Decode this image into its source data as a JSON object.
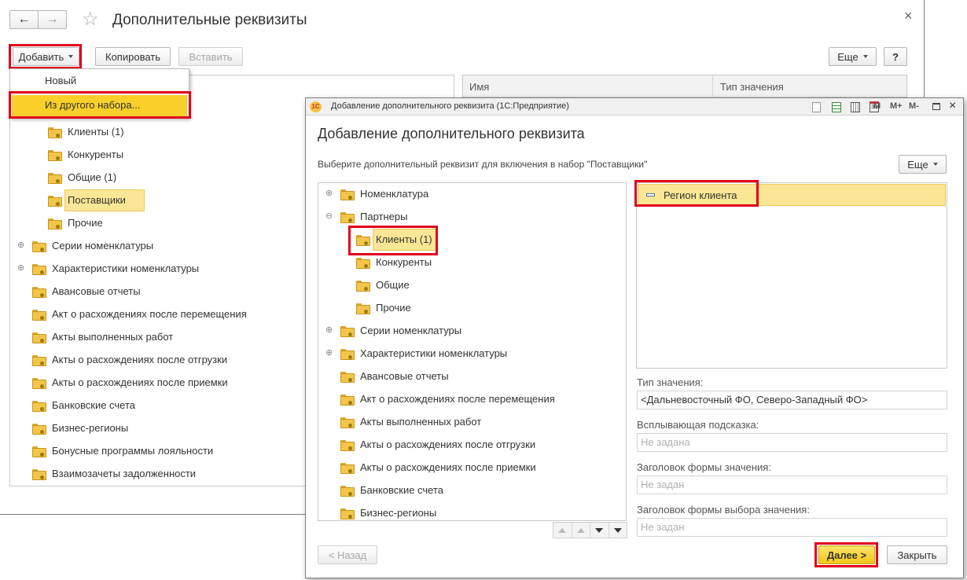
{
  "main": {
    "title": "Дополнительные реквизиты",
    "nav_back": "←",
    "nav_forward": "→",
    "star": "☆",
    "close": "×",
    "toolbar": {
      "add": "Добавить",
      "copy": "Копировать",
      "paste": "Вставить",
      "more": "Еще",
      "help": "?"
    },
    "columns": {
      "name": "Имя",
      "type": "Тип значения"
    },
    "dropdown": {
      "items": [
        "Новый",
        "Из другого набора..."
      ]
    },
    "tree": [
      {
        "label": "Клиенты (1)",
        "level": 2
      },
      {
        "label": "Конкуренты",
        "level": 2
      },
      {
        "label": "Общие (1)",
        "level": 2
      },
      {
        "label": "Поставщики",
        "level": 2,
        "selected": true
      },
      {
        "label": "Прочие",
        "level": 2
      },
      {
        "label": "Серии номенклатуры",
        "level": 1,
        "expandable": true
      },
      {
        "label": "Характеристики номенклатуры",
        "level": 1,
        "expandable": true
      },
      {
        "label": "Авансовые отчеты",
        "level": 1
      },
      {
        "label": "Акт о расхождениях после перемещения",
        "level": 1
      },
      {
        "label": "Акты выполненных работ",
        "level": 1
      },
      {
        "label": "Акты о расхождениях после отгрузки",
        "level": 1
      },
      {
        "label": "Акты о расхождениях после приемки",
        "level": 1
      },
      {
        "label": "Банковские счета",
        "level": 1
      },
      {
        "label": "Бизнес-регионы",
        "level": 1
      },
      {
        "label": "Бонусные программы лояльности",
        "level": 1
      },
      {
        "label": "Взаимозачеты задолженности",
        "level": 1
      }
    ]
  },
  "dialog": {
    "window_title": "Добавление дополнительного реквизита  (1С:Предприятие)",
    "app_logo": "1С",
    "title": "Добавление дополнительного реквизита",
    "subtitle": "Выберите дополнительный реквизит для включения в набор \"Поставщики\"",
    "more": "Еще",
    "winbtns": {
      "m": "M",
      "mplus": "M+",
      "mminus": "M-",
      "close": "×",
      "cal": "31"
    },
    "tree": [
      {
        "label": "Номенклатура",
        "level": 1,
        "expandable": true,
        "sign": "⊕"
      },
      {
        "label": "Партнеры",
        "level": 1,
        "expandable": true,
        "sign": "⊖"
      },
      {
        "label": "Клиенты (1)",
        "level": 2,
        "selected": true
      },
      {
        "label": "Конкуренты",
        "level": 2
      },
      {
        "label": "Общие",
        "level": 2
      },
      {
        "label": "Прочие",
        "level": 2
      },
      {
        "label": "Серии номенклатуры",
        "level": 1,
        "expandable": true,
        "sign": "⊕"
      },
      {
        "label": "Характеристики номенклатуры",
        "level": 1,
        "expandable": true,
        "sign": "⊕"
      },
      {
        "label": "Авансовые отчеты",
        "level": 1
      },
      {
        "label": "Акт о расхождениях после перемещения",
        "level": 1
      },
      {
        "label": "Акты выполненных работ",
        "level": 1
      },
      {
        "label": "Акты о расхождениях после отгрузки",
        "level": 1
      },
      {
        "label": "Акты о расхождениях после приемки",
        "level": 1
      },
      {
        "label": "Банковские счета",
        "level": 1
      },
      {
        "label": "Бизнес-регионы",
        "level": 1
      }
    ],
    "attribute_item": "Регион клиента",
    "fields": {
      "type_label": "Тип значения:",
      "type_value": "<Дальневосточный ФО, Северо-Западный ФО>",
      "tooltip_label": "Всплывающая подсказка:",
      "tooltip_placeholder": "Не задана",
      "form_header_label": "Заголовок формы значения:",
      "form_header_placeholder": "Не задан",
      "choice_header_label": "Заголовок формы выбора значения:",
      "choice_header_placeholder": "Не задан"
    },
    "buttons": {
      "back": "< Назад",
      "next": "Далее >",
      "close": "Закрыть"
    }
  },
  "colors": {
    "highlight": "#e0001b",
    "selection": "#fbe695",
    "accent_button": "#f7d02e"
  }
}
